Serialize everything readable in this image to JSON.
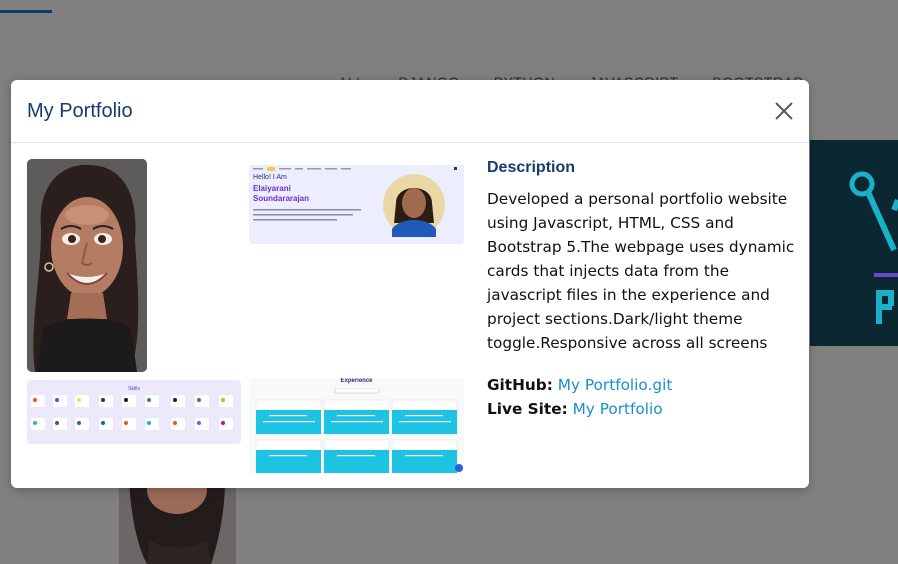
{
  "background": {
    "nav_items": [
      "ALL",
      "DJANGO",
      "PYTHON",
      "JAVASCRIPT",
      "BOOTSTRAP"
    ],
    "accent_color": "#0d3a66"
  },
  "modal": {
    "title": "My Portfolio",
    "close_icon": "close-icon",
    "screenshots": {
      "hero": {
        "greeting": "Hello! I Am",
        "name_line1": "Elaiyarani",
        "name_line2": "Soundararajan"
      },
      "experience": {
        "heading": "Experience"
      },
      "skills": {
        "heading": "Skills"
      }
    },
    "description": {
      "heading": "Description",
      "text": "Developed a personal portfolio website using Javascript, HTML, CSS and Bootstrap 5.The webpage uses dynamic cards that injects data from the javascript files in the experience and project sections.Dark/light theme toggle.Responsive across all screens"
    },
    "links": {
      "github_label": "GitHub:",
      "github_text": "My Portfolio.git",
      "live_label": "Live Site:",
      "live_text": "My Portfolio"
    }
  },
  "colors": {
    "title": "#143d6e",
    "link": "#1a8fcf",
    "overlay": "#808080"
  }
}
